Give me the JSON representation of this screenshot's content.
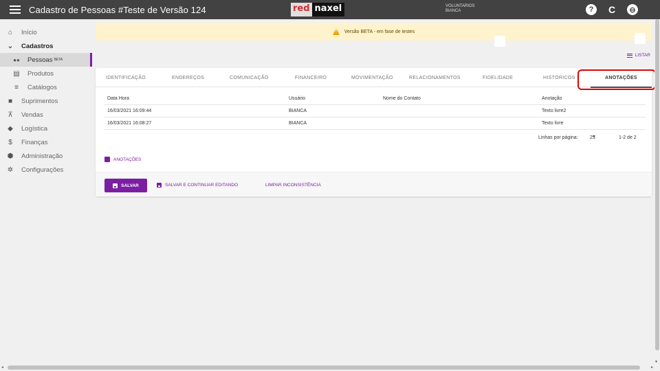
{
  "appbar": {
    "title": "Cadastro de Pessoas #Teste de Versão 124",
    "logo_red": "red",
    "logo_naxel": "naxel",
    "org": "VOLUNTARIOS",
    "user": "BIANCA",
    "icons": [
      "help-icon",
      "refresh-icon",
      "account-icon"
    ],
    "help_glyph": "?",
    "refresh_glyph": "C",
    "account_glyph": "⊖"
  },
  "sidebar": {
    "items": [
      {
        "label": "Início",
        "icon": "home-icon",
        "glyph": "⌂"
      },
      {
        "label": "Cadastros",
        "icon": "chevron-down-icon",
        "glyph": "⌄"
      },
      {
        "label": "Pessoas",
        "badge": "BETA",
        "icon": "people-icon",
        "glyph": "👥"
      },
      {
        "label": "Produtos",
        "icon": "book-icon",
        "glyph": "▤"
      },
      {
        "label": "Catálogos",
        "icon": "list-icon",
        "glyph": "≡"
      },
      {
        "label": "Suprimentos",
        "icon": "briefcase-icon",
        "glyph": "■"
      },
      {
        "label": "Vendas",
        "icon": "cart-icon",
        "glyph": "⊼"
      },
      {
        "label": "Logística",
        "icon": "directions-icon",
        "glyph": "◆"
      },
      {
        "label": "Finanças",
        "icon": "dollar-icon",
        "glyph": "$"
      },
      {
        "label": "Administração",
        "icon": "shield-icon",
        "glyph": "⬢"
      },
      {
        "label": "Configurações",
        "icon": "gear-icon",
        "glyph": "✲"
      }
    ]
  },
  "banner": {
    "text": "Versão BETA - em fase de testes"
  },
  "listar": {
    "label": "LISTAR"
  },
  "tabs": [
    {
      "label": "IDENTIFICAÇÃO"
    },
    {
      "label": "ENDEREÇOS"
    },
    {
      "label": "COMUNICAÇÃO"
    },
    {
      "label": "FINANCEIRO"
    },
    {
      "label": "MOVIMENTAÇÃO"
    },
    {
      "label": "RELACIONAMENTOS"
    },
    {
      "label": "FIDELIDADE"
    },
    {
      "label": "HISTÓRICOS"
    },
    {
      "label": "ANOTAÇÕES"
    }
  ],
  "table": {
    "headers": [
      "Data Hora",
      "Usuário",
      "Nome do Contato",
      "Anotação"
    ],
    "rows": [
      [
        "16/03/2021 16:09:44",
        "BIANCA",
        "",
        "Texto livre2"
      ],
      [
        "16/03/2021 16:08:27",
        "BIANCA",
        "",
        "Texto livre"
      ]
    ]
  },
  "pager": {
    "rows_label": "Linhas por página:",
    "rows_value": "25",
    "range": "1-2 de 2"
  },
  "section_link": {
    "label": "ANOTAÇÕES"
  },
  "actions": {
    "save": "SALVAR",
    "save_continue": "SALVAR E CONTINUAR EDITANDO",
    "clear": "LIMPAR INCONSISTÊNCIA"
  },
  "colors": {
    "appbar": "#424242",
    "accent": "#7b1fa2",
    "banner": "#fff3cd",
    "highlight": "#e00000"
  }
}
